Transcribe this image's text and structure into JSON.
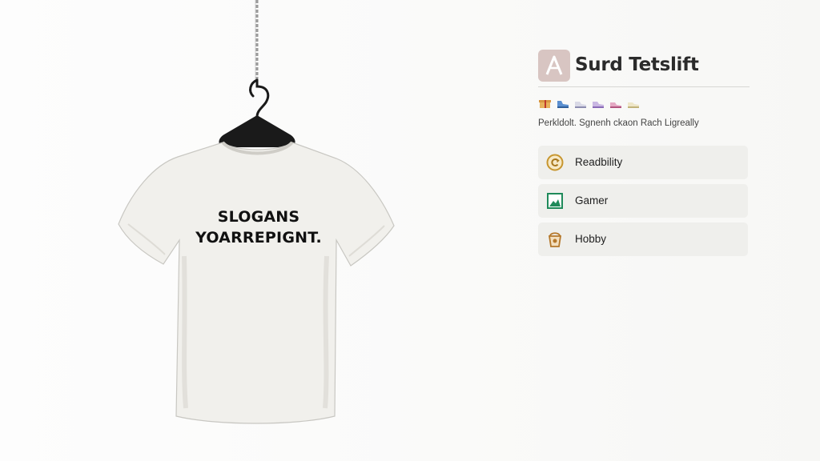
{
  "product": {
    "slogan_line1": "SLOGANS",
    "slogan_line2": "YOARREPIGNT.",
    "shirt_color": "#f1f0ec",
    "hanger_color": "#1a1a1a",
    "chain_color": "#9a9a9a"
  },
  "panel": {
    "app_title": "Surd Tetslift",
    "app_icon": "letter-a-icon",
    "app_icon_color": "#d8c5c2",
    "emoji_icons": [
      "gift-icon",
      "shoe-icon",
      "sneaker-icon",
      "sneaker-icon",
      "sneaker-icon",
      "sneaker-icon"
    ],
    "tagline": "Perkldolt. Sgnenh ckaon Rach Ligreally",
    "options": [
      {
        "label": "Readbility",
        "icon": "circle-arrow-icon",
        "icon_color": "#c7962f"
      },
      {
        "label": "Gamer",
        "icon": "image-icon",
        "icon_color": "#1f8a5a"
      },
      {
        "label": "Hobby",
        "icon": "bucket-icon",
        "icon_color": "#b5782b"
      }
    ]
  }
}
